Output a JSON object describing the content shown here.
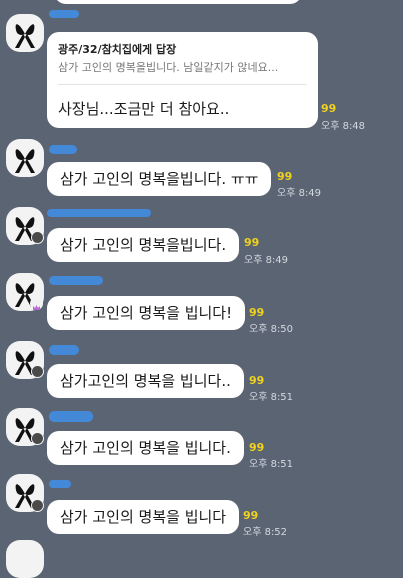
{
  "messages": [
    {
      "reply_to": "광주/32/참치집에게 답장",
      "quote": "삼가 고인의 명복을빕니다. 남일같지가 않네요...",
      "text": "사장님...조금만 더 참아요..",
      "read_count": "99",
      "time": "오후 8:48"
    },
    {
      "text": "삼가 고인의 명복을빕니다. ㅠㅠ",
      "read_count": "99",
      "time": "오후 8:49"
    },
    {
      "text": "삼가 고인의 명복을빕니다.",
      "read_count": "99",
      "time": "오후 8:49"
    },
    {
      "text": "삼가 고인의 명복을 빕니다!",
      "read_count": "99",
      "time": "오후 8:50"
    },
    {
      "text": "삼가고인의 명복을 빕니다..",
      "read_count": "99",
      "time": "오후 8:51"
    },
    {
      "text": "삼가 고인의 명복을 빕니다.",
      "read_count": "99",
      "time": "오후 8:51"
    },
    {
      "text": "삼가 고인의 명복을 빕니다",
      "read_count": "99",
      "time": "오후 8:52"
    }
  ],
  "icons": {
    "avatar": "mourning-ribbon-icon",
    "badge": "profile-badge-icon",
    "crown": "crown-icon"
  },
  "colors": {
    "background": "#5a6473",
    "bubble": "#ffffff",
    "read_count": "#f2d21c",
    "redaction": "#3f8fea"
  }
}
